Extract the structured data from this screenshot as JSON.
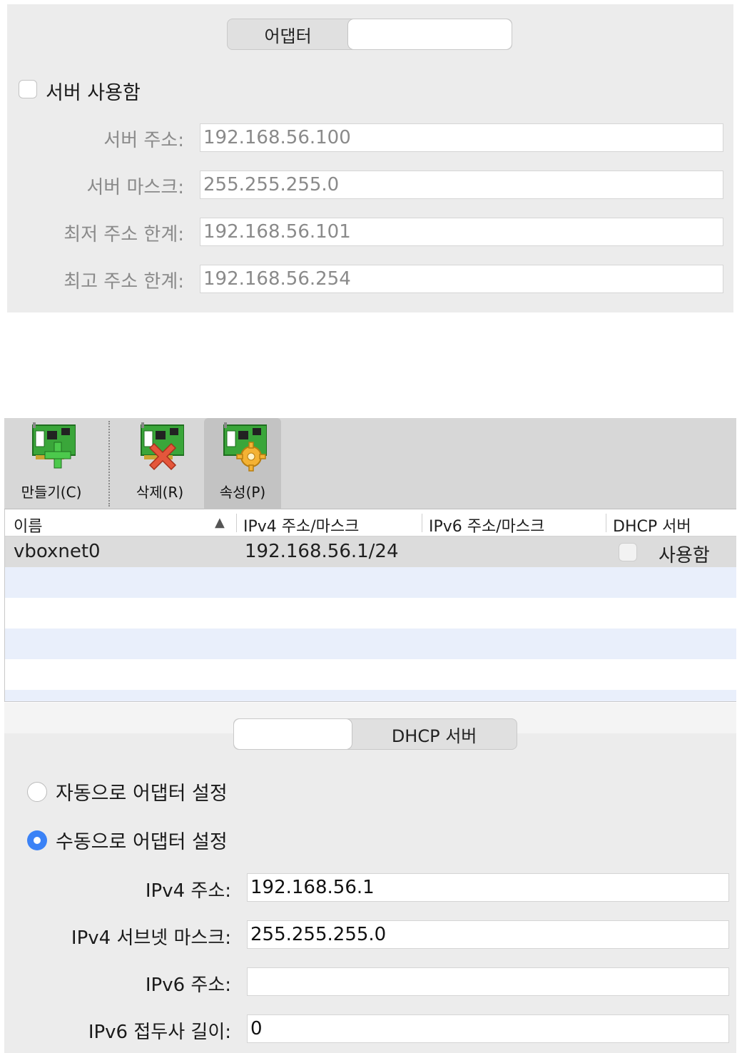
{
  "dhcp_panel": {
    "tabs": [
      {
        "label": "어댑터"
      },
      {
        "label": ""
      }
    ],
    "enable_server": {
      "label": "서버 사용함",
      "checked": false
    },
    "fields": [
      {
        "label": "서버 주소:",
        "value": "192.168.56.100"
      },
      {
        "label": "서버 마스크:",
        "value": "255.255.255.0"
      },
      {
        "label": "최저 주소 한계:",
        "value": "192.168.56.101"
      },
      {
        "label": "최고 주소 한계:",
        "value": "192.168.56.254"
      }
    ]
  },
  "toolbar": {
    "create_label": "만들기(C)",
    "remove_label": "삭제(R)",
    "properties_label": "속성(P)",
    "icons": [
      "network-card-add-icon",
      "network-card-remove-icon",
      "network-card-properties-icon"
    ]
  },
  "table": {
    "columns": [
      "이름",
      "IPv4 주소/마스크",
      "IPv6 주소/마스크",
      "DHCP 서버"
    ],
    "sort_indicator": "▲",
    "rows": [
      {
        "name": "vboxnet0",
        "ipv4": "192.168.56.1/24",
        "ipv6": "",
        "dhcp_enabled": false,
        "dhcp_label": "사용함"
      }
    ]
  },
  "adapter_panel": {
    "tabs": [
      {
        "label": ""
      },
      {
        "label": "DHCP 서버"
      }
    ],
    "radio_auto": {
      "label": "자동으로 어댑터 설정",
      "selected": false
    },
    "radio_manual": {
      "label": "수동으로 어댑터 설정",
      "selected": true
    },
    "fields": [
      {
        "label": "IPv4 주소:",
        "value": "192.168.56.1"
      },
      {
        "label": "IPv4 서브넷 마스크:",
        "value": "255.255.255.0"
      },
      {
        "label": "IPv6 주소:",
        "value": ""
      },
      {
        "label": "IPv6 접두사 길이:",
        "value": "0"
      }
    ]
  },
  "colors": {
    "panel_bg": "#ececec",
    "toolbar_bg": "#d7d7d7",
    "selected_row": "#dcdcdc",
    "alt_row": "#e9effb",
    "radio_accent": "#3b82f6"
  }
}
